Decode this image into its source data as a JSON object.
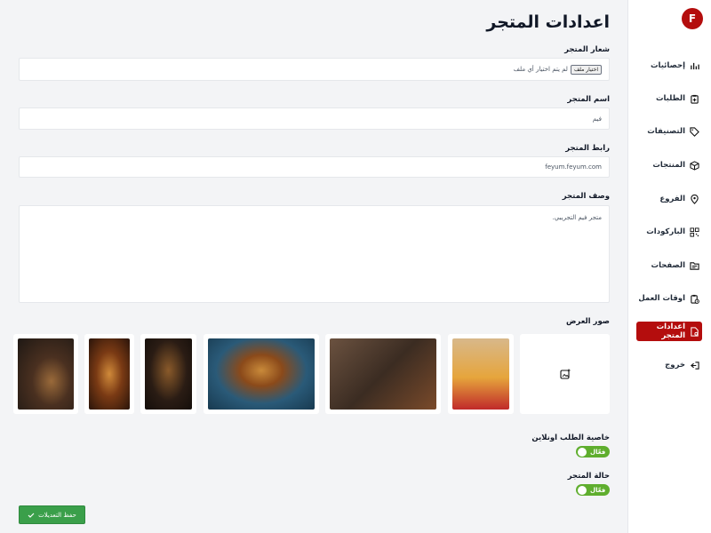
{
  "sidebar": {
    "logo_text": "F",
    "items": [
      {
        "label": "إحصائيات",
        "icon": "stats-icon"
      },
      {
        "label": "الطلبات",
        "icon": "orders-icon"
      },
      {
        "label": "التصنيفات",
        "icon": "tag-icon"
      },
      {
        "label": "المنتجات",
        "icon": "box-icon"
      },
      {
        "label": "الفروع",
        "icon": "location-icon"
      },
      {
        "label": "الباركودات",
        "icon": "qrcode-icon"
      },
      {
        "label": "الصفحات",
        "icon": "folder-icon"
      },
      {
        "label": "اوقات العمل",
        "icon": "clipboard-clock-icon"
      },
      {
        "label": "اعدادات المتجر",
        "icon": "settings-doc-icon",
        "active": true
      },
      {
        "label": "خروج",
        "icon": "logout-icon"
      }
    ],
    "accent": "#b40d0d"
  },
  "main": {
    "title": "اعدادات المتجر",
    "logo_field": {
      "label": "شعار المتجر",
      "button": "اختيار ملف",
      "status": "لم يتم اختيار أي ملف"
    },
    "name_field": {
      "label": "اسم المتجر",
      "value": "فيم"
    },
    "url_field": {
      "label": "رابط المتجر",
      "value": "feyum.feyum.com"
    },
    "description_field": {
      "label": "وصف المتجر",
      "value": "متجر فيم التجريبي."
    },
    "gallery": {
      "label": "صور العرض",
      "upload_icon": "add-image-icon",
      "images": [
        {
          "alt": "burgers on board",
          "color": "#3a2a1e"
        },
        {
          "alt": "burger closeup",
          "color": "#5b3317"
        },
        {
          "alt": "burger held",
          "color": "#2a1c14"
        },
        {
          "alt": "big cheeseburger",
          "color": "#274c66"
        },
        {
          "alt": "phone photo burgers",
          "color": "#4a3a2e"
        },
        {
          "alt": "woman eating burger",
          "color": "#c48a3c"
        }
      ]
    },
    "online_order": {
      "label": "خاصية الطلب اونلاين",
      "state": "فعّال"
    },
    "store_status": {
      "label": "حالة المتجر",
      "state": "فعّال"
    },
    "save_button": "حفظ التعديلات",
    "toggle_color": "#5fae2e",
    "save_color": "#3a9f4a"
  }
}
